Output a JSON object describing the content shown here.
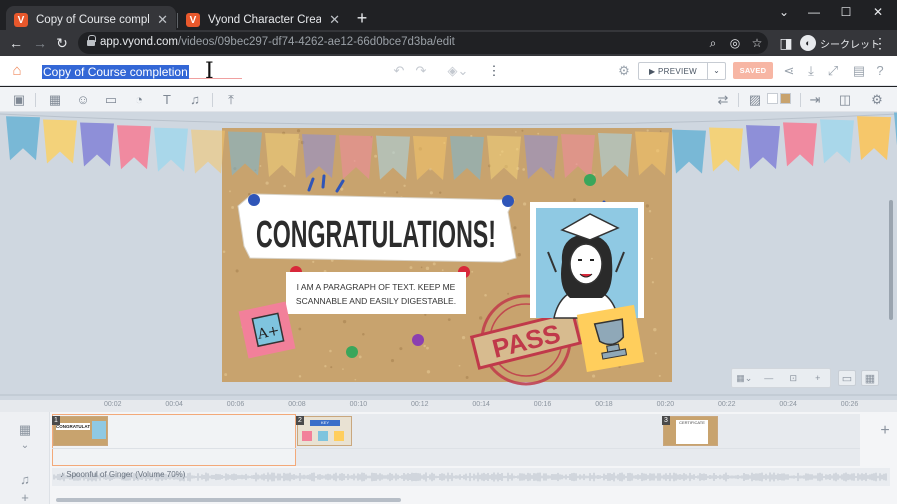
{
  "browser": {
    "tabs": [
      {
        "label": "Copy of Course completion - Vyo",
        "active": true
      },
      {
        "label": "Vyond Character Creator",
        "active": false
      }
    ],
    "url_host": "app.vyond.com",
    "url_path": "/videos/09bec297-df74-4262-ae12-66d0bce7d3ba/edit",
    "profile_label": "シークレット"
  },
  "app": {
    "video_title": "Copy of Course completion",
    "preview_label": "PREVIEW",
    "saved_label": "SAVED"
  },
  "scene": {
    "headline": "CONGRATULATIONS!",
    "paragraph_line1": "I AM A PARAGRAPH OF TEXT. KEEP ME",
    "paragraph_line2": "SCANNABLE AND EASILY DIGESTABLE.",
    "grade_note": "A+",
    "stamp_text": "PASS",
    "colors": {
      "stage_bg": "#cfd7e0",
      "corkboard": "#c8a36e",
      "accent": "#f08a5d",
      "stamp": "#c0394a"
    }
  },
  "timeline": {
    "ruler_ticks": [
      "00:02",
      "00:04",
      "00:06",
      "00:08",
      "00:10",
      "00:12",
      "00:14",
      "00:16",
      "00:18",
      "00:20",
      "00:22",
      "00:24",
      "00:26"
    ],
    "scenes": [
      {
        "number": "1",
        "thumb_title": "CONGRATULATIONS!"
      },
      {
        "number": "2",
        "thumb_title": "KEY CONCEPTS"
      },
      {
        "number": "3",
        "thumb_title": "CERTIFICATE"
      }
    ],
    "audio_label": "Spoonful of Ginger (Volume 70%)"
  },
  "icons": {
    "toolbar": [
      "scenes-icon",
      "props-icon",
      "characters-icon",
      "objects-icon",
      "charts-icon",
      "text-icon",
      "audio-icon",
      "upload-icon"
    ],
    "right_tools": [
      "swap-icon",
      "image-icon",
      "color-icon",
      "enter-icon",
      "camera-icon",
      "settings-icon"
    ]
  }
}
